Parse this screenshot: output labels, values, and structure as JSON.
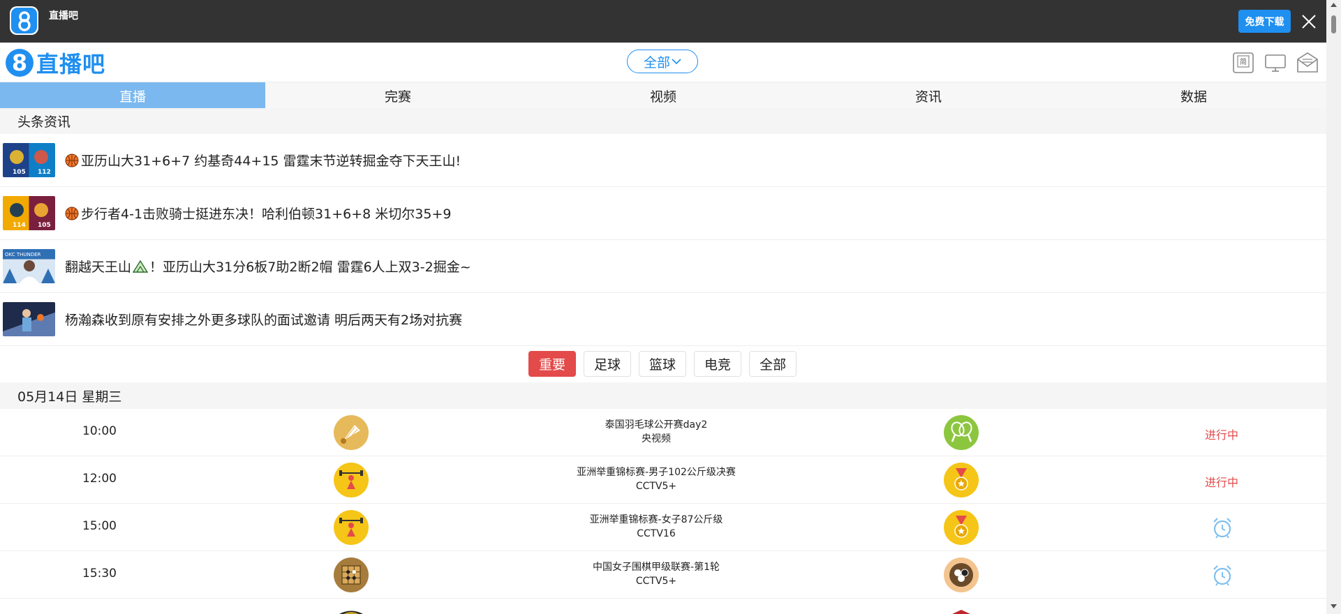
{
  "appbar": {
    "title": "直播吧",
    "download_label": "免费下载",
    "logo_glyph": "8"
  },
  "header": {
    "logo_glyph": "8",
    "site_name": "直播吧",
    "filter_label": "全部"
  },
  "nav": {
    "tabs": [
      "直播",
      "完赛",
      "视频",
      "资讯",
      "数据"
    ],
    "active": 0
  },
  "news": {
    "section_title": "头条资讯",
    "items": [
      {
        "text": "亚历山大31+6+7 约基奇44+15 雷霆末节逆转掘金夺下天王山!",
        "icon": "basketball-icon",
        "thumb_left": "105",
        "thumb_right": "112",
        "thumb_colors": [
          "#1d428a",
          "#0e7fc7"
        ]
      },
      {
        "text": "步行者4-1击败骑士挺进东决！哈利伯顿31+6+8 米切尔35+9",
        "icon": "basketball-icon",
        "thumb_left": "114",
        "thumb_right": "105",
        "thumb_colors": [
          "#f2a900",
          "#7a1f3d"
        ]
      },
      {
        "text_before": "翻越天王山",
        "text_after": "！亚历山大31分6板7助2断2帽 雷霆6人上双3-2掘金~",
        "icon": "mountain-icon",
        "thumb_label": "OKC THUNDER",
        "thumb_colors": [
          "#2f6fb4",
          "#d9e6f3"
        ]
      },
      {
        "text": "杨瀚森收到原有安排之外更多球队的面试邀请 明后两天有2场对抗赛",
        "icon": "",
        "thumb_colors": [
          "#1e2b4a",
          "#5d7bb0"
        ]
      }
    ]
  },
  "categories": {
    "items": [
      "重要",
      "足球",
      "篮球",
      "电竞",
      "全部"
    ],
    "active": 0
  },
  "schedule": {
    "date_label": "05月14日 星期三",
    "matches": [
      {
        "time": "10:00",
        "title": "泰国羽毛球公开赛day2",
        "channel": "央视频",
        "left_icon": "shuttlecock-icon",
        "right_icon": "tennis-racket-icon",
        "status": "进行中"
      },
      {
        "time": "12:00",
        "title": "亚洲举重锦标赛-男子102公斤级决赛",
        "channel": "CCTV5+",
        "left_icon": "weightlifting-icon",
        "right_icon": "medal-icon",
        "status": "进行中"
      },
      {
        "time": "15:00",
        "title": "亚洲举重锦标赛-女子87公斤级",
        "channel": "CCTV16",
        "left_icon": "weightlifting-icon",
        "right_icon": "medal-icon",
        "status": ""
      },
      {
        "time": "15:30",
        "title": "中国女子围棋甲级联赛-第1轮",
        "channel": "CCTV5+",
        "left_icon": "go-board-icon",
        "right_icon": "go-stones-icon",
        "status": ""
      }
    ]
  },
  "colors": {
    "accent": "#1f8ff0",
    "nav_active": "#7bb8ef",
    "live_red": "#e34a4a",
    "appbar": "#333333"
  }
}
